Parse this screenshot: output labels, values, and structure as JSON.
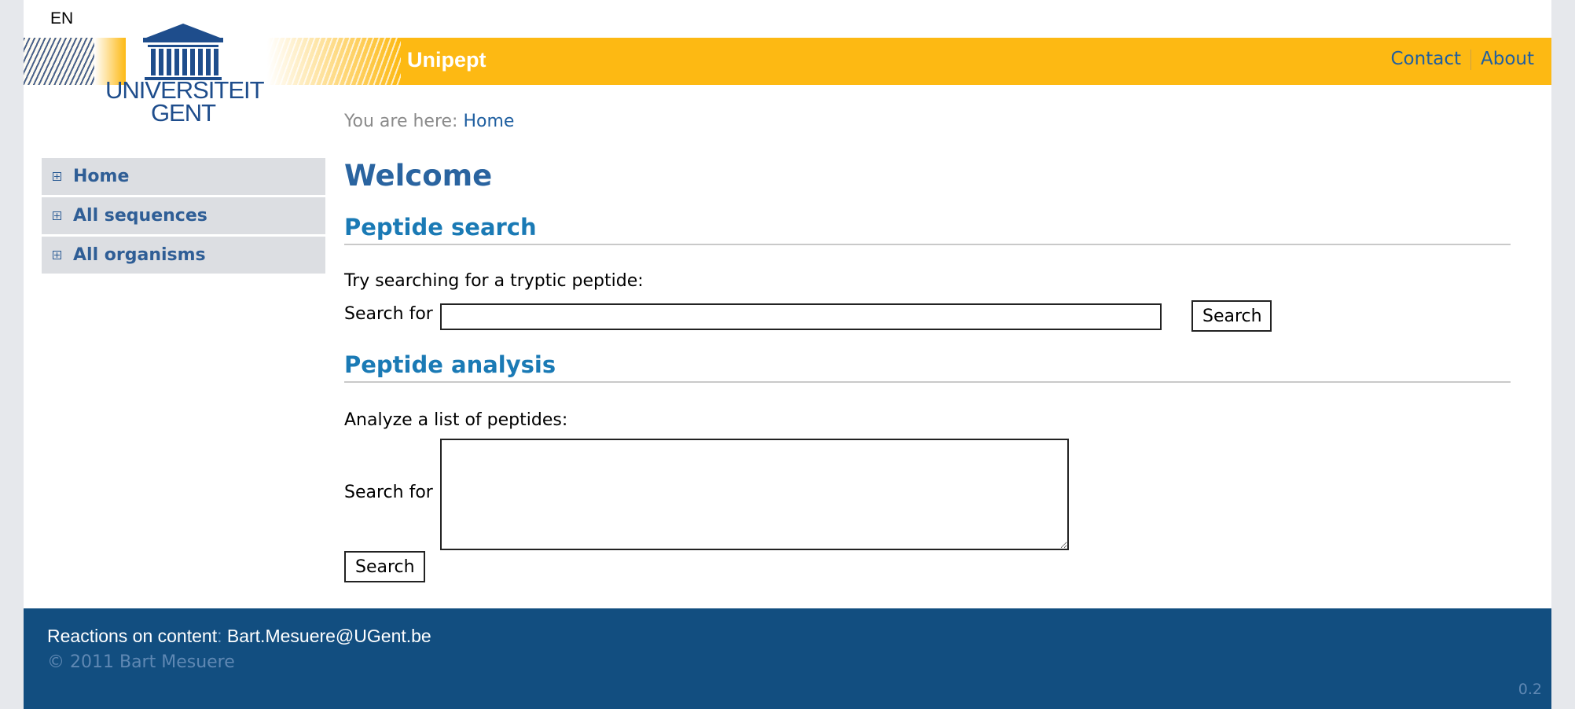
{
  "language": "EN",
  "header": {
    "site_title": "Unipept",
    "links": [
      {
        "label": "Contact"
      },
      {
        "label": "About"
      }
    ]
  },
  "logo": {
    "line1": "UNIVERSITEIT",
    "line2": "GENT"
  },
  "breadcrumb": {
    "prefix": "You are here:",
    "current": "Home"
  },
  "sidebar": {
    "items": [
      {
        "label": "Home",
        "icon": "expand-plus-icon"
      },
      {
        "label": "All sequences",
        "icon": "expand-plus-icon"
      },
      {
        "label": "All organisms",
        "icon": "expand-plus-icon"
      }
    ]
  },
  "main": {
    "title": "Welcome",
    "peptide_search": {
      "heading": "Peptide search",
      "intro": "Try searching for a tryptic peptide:",
      "label": "Search for",
      "input_value": "",
      "button": "Search"
    },
    "peptide_analysis": {
      "heading": "Peptide analysis",
      "intro": "Analyze a list of peptides:",
      "label": "Search for",
      "textarea_value": "",
      "button": "Search"
    }
  },
  "footer": {
    "reactions_label": "Reactions on content",
    "colon": ":",
    "email": "Bart.Mesuere@UGent.be",
    "copyright": "© 2011 Bart Mesuere",
    "version": "0.2"
  },
  "colors": {
    "header_yellow": "#fdb913",
    "footer_blue": "#124e80",
    "link_blue": "#1f5fa0",
    "heading_blue": "#1a7ab5",
    "sidebar_bg": "#dcdee2"
  }
}
